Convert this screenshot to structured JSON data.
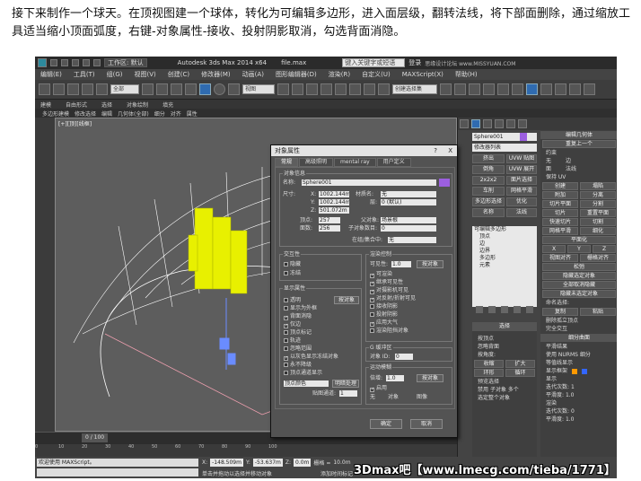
{
  "instruction": "接下来制作一个球天。在顶视图建一个球体，转化为可编辑多边形，进入面层级，翻转法线，将下部面删除，通过缩放工具适当缩小顶面弧度，右键-对象属性-接收、投射阴影取消，勾选背面消隐。",
  "app": {
    "workspace": "工作区: 默认",
    "title": "Autodesk 3ds Max  2014 x64",
    "file": "file.max",
    "search_placeholder": "键入关键字或短语",
    "login": "登录",
    "watermark_top": "思缘设计论坛 www.MISSYUAN.COM"
  },
  "menu": [
    "编辑(E)",
    "工具(T)",
    "组(G)",
    "视图(V)",
    "创建(C)",
    "修改器(M)",
    "动画(A)",
    "图形编辑器(D)",
    "渲染(R)",
    "自定义(U)",
    "MAXScript(X)",
    "帮助(H)"
  ],
  "toolbar": {
    "filter": "全部",
    "view": "视图",
    "selset": "创建选择集"
  },
  "ribbon": {
    "tabs": [
      "建模",
      "自由形式",
      "选择",
      "对象绘制",
      "填充"
    ],
    "sub": [
      "多边形建模",
      "修改选择",
      "编辑",
      "几何体(全部)",
      "细分",
      "对齐",
      "属性"
    ]
  },
  "viewport": {
    "label": "[+][顶][线框]"
  },
  "timeline": {
    "frame": "0 / 100"
  },
  "ruler": [
    "0",
    "10",
    "20",
    "30",
    "40",
    "50",
    "60",
    "70",
    "80",
    "90",
    "100"
  ],
  "status": {
    "welcome": "欢迎使用 MAXScript。",
    "hint": "单击并拖动以选择并移动对象",
    "x_label": "X:",
    "x": "-148.509m",
    "y_label": "Y:",
    "y": "-53.637m",
    "z_label": "Z:",
    "z": "0.0m",
    "grid_label": "栅格 =",
    "grid": "10.0m",
    "addtime": "添加时间标记",
    "watermark": "3Dmax吧【www.lmecg.com/tieba/1771】"
  },
  "cmd": {
    "objname": "Sphere001",
    "modlist": "修改器列表",
    "buttons": [
      "挤出",
      "UVW 贴图",
      "倒角",
      "UVW 展开",
      "2x2x2",
      "面片选择",
      "车削",
      "网格平滑",
      "多边形选择",
      "优化",
      "名称",
      "法线"
    ],
    "stack": [
      "可编辑多边形",
      "顶点",
      "边",
      "边界",
      "多边形",
      "元素"
    ],
    "sel_title": "选择",
    "sel_items": [
      "按顶点",
      "忽略背面",
      "按角度:",
      "收缩",
      "扩大",
      "环形",
      "循环",
      "预览选择",
      "禁用",
      "子对象",
      "多个",
      "选定整个对象"
    ],
    "r_title": "编辑几何体",
    "r_repeat": "重复上一个",
    "r_constraint": "约束",
    "r_none": "无",
    "r_edge": "边",
    "r_face": "面",
    "r_normal": "法线",
    "r_keepuv": "保持 UV",
    "r_create": "创建",
    "r_collapse": "塌陷",
    "r_attach": "附加",
    "r_detach": "分离",
    "r_slice_plane": "切片平面",
    "r_split": "分割",
    "r_slice": "切片",
    "r_reset": "重置平面",
    "r_quickslice": "快速切片",
    "r_cut": "切割",
    "r_meshsmooth": "网格平滑",
    "r_tess": "细化",
    "r_planarize": "平面化",
    "r_xyz": [
      "X",
      "Y",
      "Z"
    ],
    "r_viewalign": "视图对齐",
    "r_gridalign": "栅格对齐",
    "r_relax": "松弛",
    "r_hide_sel": "隐藏选定对象",
    "r_unhide": "全部取消隐藏",
    "r_hide_unsel": "隐藏未选定对象",
    "r_named": "命名选择:",
    "r_copy": "复制",
    "r_paste": "粘贴",
    "r_delete_iso": "删除孤立顶点",
    "r_fullint": "完全交互",
    "r_subdiv": "细分曲面",
    "r_smooth": "平滑结果",
    "r_nurms": "使用 NURMS 细分",
    "r_isoline": "等值线显示",
    "r_cage": "显示框架",
    "r_display": "显示",
    "r_iter_d": "迭代次数:",
    "r_iter_d_v": "1",
    "r_smooth_d": "平滑度:",
    "r_smooth_d_v": "1.0",
    "r_render": "渲染",
    "r_iter_r": "迭代次数:",
    "r_iter_r_v": "0",
    "r_smooth_r": "平滑度:",
    "r_smooth_r_v": "1.0",
    "cage_colors": [
      "#ff9900",
      "#3366ff"
    ]
  },
  "dialog": {
    "title": "对象属性",
    "help": "?",
    "close": "X",
    "tabs": [
      "常规",
      "高级照明",
      "mental ray",
      "用户定义"
    ],
    "info": {
      "group": "对象信息",
      "name_label": "名称:",
      "name": "Sphere001",
      "dim_label": "尺寸:",
      "x_label": "X:",
      "x": "1002.144m",
      "y_label": "Y:",
      "y": "1002.144m",
      "z_label": "Z:",
      "z": "501.072m",
      "verts_label": "顶点:",
      "verts": "257",
      "faces_label": "面数:",
      "faces": "256",
      "mat_label": "材质名:",
      "mat": "无",
      "layer_label": "层:",
      "layer": "0 (默认)",
      "parent_label": "父对象:",
      "parent": "场景根",
      "children_label": "子对象数目:",
      "children": "0",
      "group_label": "在组/集合中:",
      "group_val": "无",
      "color": "#9c5fe0"
    },
    "interaction": {
      "group": "交互性",
      "hide": "隐藏",
      "freeze": "冻结"
    },
    "display": {
      "group": "显示属性",
      "items": [
        "透明",
        "显示为外框",
        "背面消隐",
        "仅边",
        "顶点标记",
        "轨迹",
        "忽略范围",
        "以灰色显示冻结对象",
        "永不降级",
        "顶点通道显示"
      ],
      "checked": [
        false,
        false,
        true,
        true,
        false,
        false,
        false,
        true,
        false,
        false
      ],
      "bylayer": "按对象",
      "vcolor": "顶点颜色",
      "shaded": "明暗处理",
      "mapch": "贴图通道:",
      "mapch_v": "1"
    },
    "render": {
      "group": "渲染控制",
      "vis_label": "可见性:",
      "vis": "1.0",
      "bylayer": "按对象",
      "items": [
        "可渲染",
        "继承可见性",
        "对摄影机可见",
        "对反射/折射可见",
        "接收阴影",
        "投射阴影",
        "应用大气",
        "渲染阻挡对象"
      ],
      "checked": [
        true,
        true,
        true,
        true,
        false,
        false,
        true,
        false
      ]
    },
    "gbuf": {
      "group": "G 缓冲区",
      "id_label": "对象 ID:",
      "id": "0"
    },
    "motion": {
      "group": "运动模糊",
      "mult_label": "倍增:",
      "mult": "1.0",
      "bylayer": "按对象",
      "enable": "启用",
      "none": "无",
      "object": "对象",
      "image": "图像"
    },
    "ok": "确定",
    "cancel": "取消"
  }
}
